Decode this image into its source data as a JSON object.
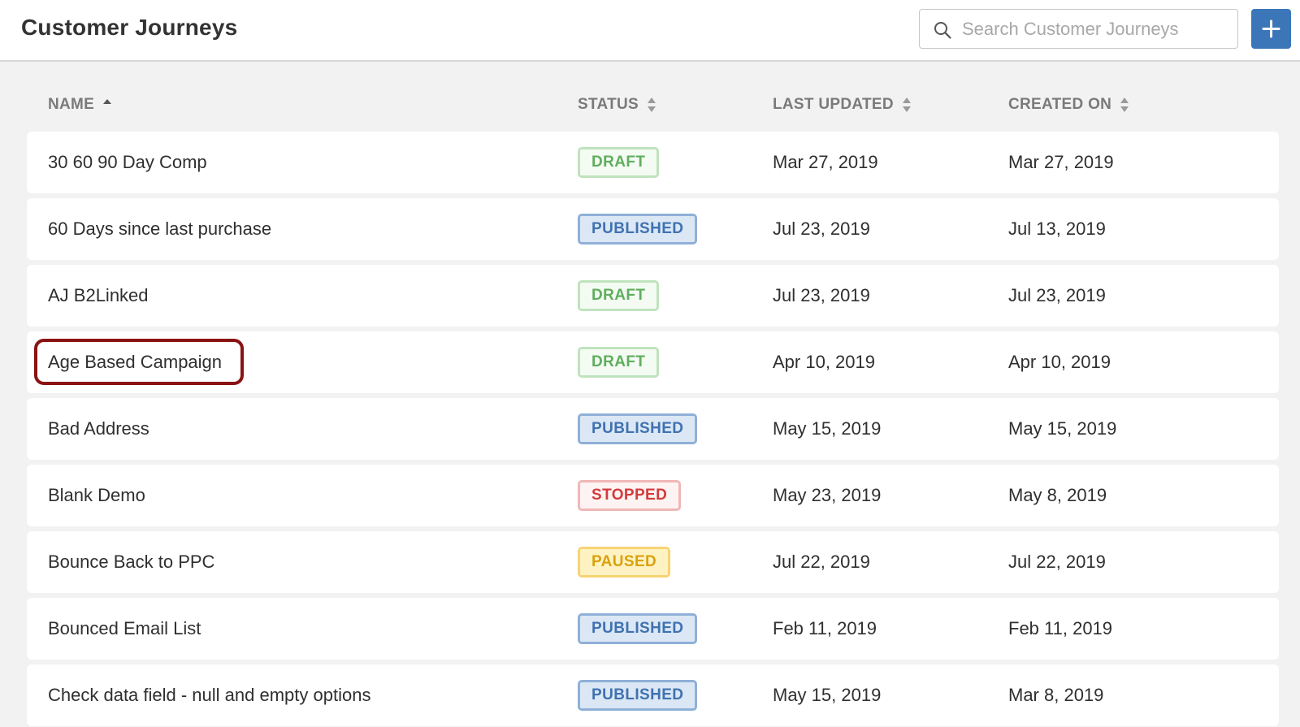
{
  "header": {
    "title": "Customer Journeys",
    "search_placeholder": "Search Customer Journeys",
    "search_value": "",
    "add_icon": "plus-icon",
    "accent_color": "#3b76b8"
  },
  "table": {
    "columns": {
      "name": "NAME",
      "status": "STATUS",
      "last_updated": "LAST UPDATED",
      "created_on": "CREATED ON"
    },
    "sort": {
      "column": "name",
      "direction": "ascending"
    },
    "rows": [
      {
        "name": "30 60 90 Day Comp",
        "status": "DRAFT",
        "last_updated": "Mar 27, 2019",
        "created_on": "Mar 27, 2019"
      },
      {
        "name": "60 Days since last purchase",
        "status": "PUBLISHED",
        "last_updated": "Jul 23, 2019",
        "created_on": "Jul 13, 2019"
      },
      {
        "name": "AJ B2Linked",
        "status": "DRAFT",
        "last_updated": "Jul 23, 2019",
        "created_on": "Jul 23, 2019"
      },
      {
        "name": "Age Based Campaign",
        "status": "DRAFT",
        "last_updated": "Apr 10, 2019",
        "created_on": "Apr 10, 2019",
        "highlighted": true
      },
      {
        "name": "Bad Address",
        "status": "PUBLISHED",
        "last_updated": "May 15, 2019",
        "created_on": "May 15, 2019"
      },
      {
        "name": "Blank Demo",
        "status": "STOPPED",
        "last_updated": "May 23, 2019",
        "created_on": "May 8, 2019"
      },
      {
        "name": "Bounce Back to PPC",
        "status": "PAUSED",
        "last_updated": "Jul 22, 2019",
        "created_on": "Jul 22, 2019"
      },
      {
        "name": "Bounced Email List",
        "status": "PUBLISHED",
        "last_updated": "Feb 11, 2019",
        "created_on": "Feb 11, 2019"
      },
      {
        "name": "Check data field - null and empty options",
        "status": "PUBLISHED",
        "last_updated": "May 15, 2019",
        "created_on": "Mar 8, 2019"
      }
    ]
  },
  "status_colors": {
    "DRAFT": "#5fae5d",
    "PUBLISHED": "#3f72b0",
    "STOPPED": "#d33b3b",
    "PAUSED": "#d9a20d"
  },
  "highlight_color": "#8b1212"
}
